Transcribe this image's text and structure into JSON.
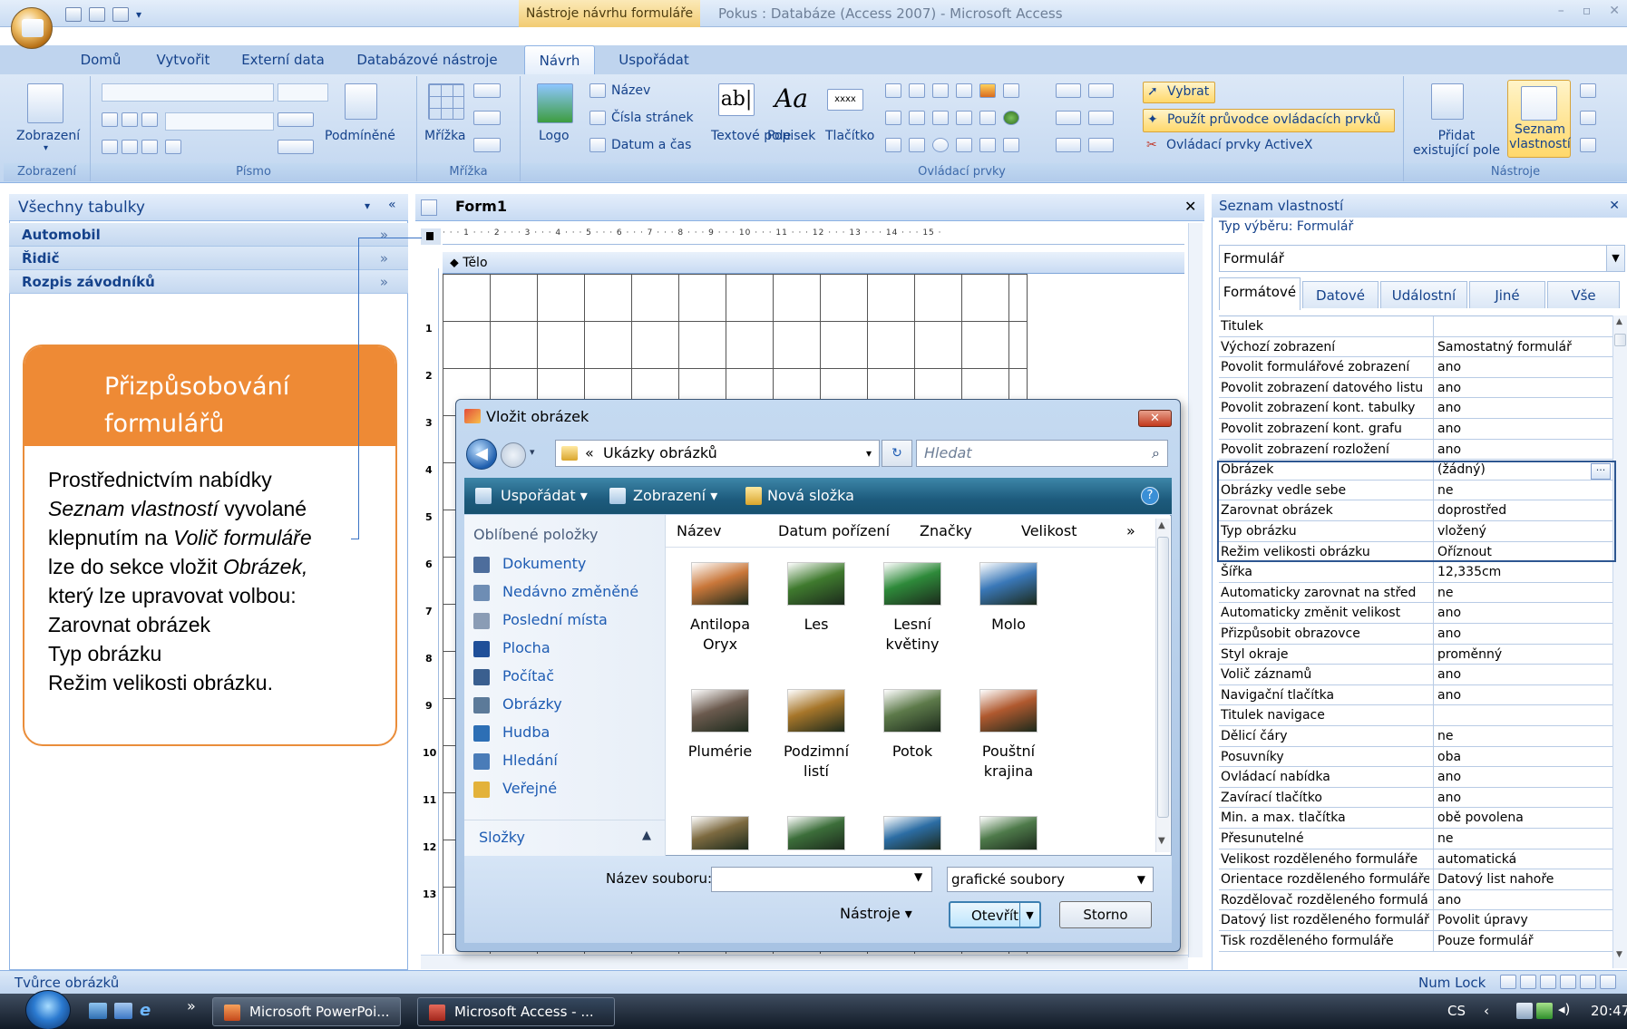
{
  "app": {
    "window_title": "Pokus : Databáze (Access 2007) - Microsoft Access",
    "context_tab": "Nástroje návrhu formuláře"
  },
  "ribbon": {
    "tabs": [
      "Domů",
      "Vytvořit",
      "Externí data",
      "Databázové nástroje",
      "Návrh",
      "Uspořádat"
    ],
    "active_tab": "Návrh",
    "groups": {
      "zobrazeni": {
        "label": "Zobrazení",
        "button": "Zobrazení"
      },
      "pismo": {
        "label": "Písmo",
        "podminene": "Podmíněné"
      },
      "mrizka": {
        "label": "Mřížka",
        "button": "Mřížka"
      },
      "ovladaci_prvky": {
        "label": "Ovládací prvky",
        "logo": "Logo",
        "nazev": "Název",
        "cisla_stranek": "Čísla stránek",
        "datum_cas": "Datum a čas",
        "textove_pole": "Textové pole",
        "textove_pole_ico": "ab|",
        "popisek": "Popisek",
        "popisek_ico": "Aa",
        "tlacitko": "Tlačítko",
        "tlacitko_ico": "xxxx",
        "vybrat": "Vybrat",
        "pouzit_pruvodce": "Použít průvodce ovládacích prvků",
        "activex": "Ovládací prvky ActiveX"
      },
      "nastroje": {
        "label": "Nástroje",
        "pridat_pole": "Přidat existující pole",
        "seznam_vlastnosti": "Seznam vlastností"
      }
    }
  },
  "nav_pane": {
    "title": "Všechny tabulky",
    "groups": [
      "Automobil",
      "Řidič",
      "Rozpis závodníků"
    ]
  },
  "callout": {
    "title": "Přizpůsobování formulářů",
    "lines": [
      {
        "plain": "Prostřednictvím nabídky",
        "italic": ""
      },
      {
        "plain": "",
        "italic": "Seznam vlastností",
        "after": " vyvolané"
      },
      {
        "plain": "klepnutím na ",
        "italic": "Volič formuláře"
      },
      {
        "plain": "lze do sekce vložit ",
        "italic": "Obrázek,"
      },
      {
        "plain": "který lze upravovat volbou:",
        "italic": ""
      },
      {
        "plain": "Zarovnat obrázek",
        "italic": ""
      },
      {
        "plain": "Typ obrázku",
        "italic": ""
      },
      {
        "plain": "Režim velikosti obrázku.",
        "italic": ""
      }
    ]
  },
  "form_doc": {
    "tab": "Form1",
    "section": "Tělo",
    "ruler": "· · · 1 · · · 2 · · · 3 · · · 4 · · · 5 · · · 6 · · · 7 · · · 8 · · · 9 · · · 10 · · · 11 · · · 12 · · · 13 · · · 14 · · · 15 ·",
    "vruler": [
      "1",
      "2",
      "3",
      "4",
      "5",
      "6",
      "7",
      "8",
      "9",
      "10",
      "11",
      "12",
      "13"
    ]
  },
  "dialog": {
    "title": "Vložit obrázek",
    "address": "Ukázky obrázků",
    "address_prefix": "«",
    "search_placeholder": "Hledat",
    "toolbar": {
      "organize": "Uspořádat",
      "views": "Zobrazení",
      "new_folder": "Nová složka"
    },
    "favorites_label": "Oblíbené položky",
    "favorites": [
      "Dokumenty",
      "Nedávno změněné",
      "Poslední místa",
      "Plocha",
      "Počítač",
      "Obrázky",
      "Hudba",
      "Hledání",
      "Veřejné"
    ],
    "folders_label": "Složky",
    "columns": [
      "Název",
      "Datum pořízení",
      "Značky",
      "Velikost"
    ],
    "files": [
      {
        "name": "Antilopa Oryx",
        "color": "#c9773a"
      },
      {
        "name": "Les",
        "color": "#3f7a2e"
      },
      {
        "name": "Lesní květiny",
        "color": "#2e8a3a"
      },
      {
        "name": "Molo",
        "color": "#3a78b8"
      },
      {
        "name": "Plumérie",
        "color": "#6b5a4e"
      },
      {
        "name": "Podzimní listí",
        "color": "#a7762a"
      },
      {
        "name": "Potok",
        "color": "#5d7a4a"
      },
      {
        "name": "Pouštní krajina",
        "color": "#b0592f"
      },
      {
        "name": "",
        "color": "#7d6a40"
      },
      {
        "name": "",
        "color": "#3c6e3a"
      },
      {
        "name": "",
        "color": "#2c6da4"
      },
      {
        "name": "",
        "color": "#4e7a4a"
      }
    ],
    "filename_label": "Název souboru:",
    "filename_value": "",
    "filetype": "grafické soubory",
    "tools": "Nástroje",
    "open": "Otevřít",
    "cancel": "Storno"
  },
  "property_sheet": {
    "title": "Seznam vlastností",
    "selection_type": "Typ výběru:  Formulář",
    "object": "Formulář",
    "tabs": [
      "Formátové",
      "Datové",
      "Událostní",
      "Jiné",
      "Vše"
    ],
    "active_tab": "Formátové",
    "rows": [
      {
        "name": "Titulek",
        "value": ""
      },
      {
        "name": "Výchozí zobrazení",
        "value": "Samostatný formulář"
      },
      {
        "name": "Povolit formulářové zobrazení",
        "value": "ano"
      },
      {
        "name": "Povolit zobrazení datového listu",
        "value": "ano"
      },
      {
        "name": "Povolit zobrazení kont. tabulky",
        "value": "ano"
      },
      {
        "name": "Povolit zobrazení kont. grafu",
        "value": "ano"
      },
      {
        "name": "Povolit zobrazení rozložení",
        "value": "ano"
      },
      {
        "name": "Obrázek",
        "value": "(žádný)"
      },
      {
        "name": "Obrázky vedle sebe",
        "value": "ne"
      },
      {
        "name": "Zarovnat obrázek",
        "value": "doprostřed"
      },
      {
        "name": "Typ obrázku",
        "value": "vložený"
      },
      {
        "name": "Režim velikosti obrázku",
        "value": "Oříznout"
      },
      {
        "name": "Šířka",
        "value": "12,335cm"
      },
      {
        "name": "Automaticky zarovnat na střed",
        "value": "ne"
      },
      {
        "name": "Automaticky změnit velikost",
        "value": "ano"
      },
      {
        "name": "Přizpůsobit obrazovce",
        "value": "ano"
      },
      {
        "name": "Styl okraje",
        "value": "proměnný"
      },
      {
        "name": "Volič záznamů",
        "value": "ano"
      },
      {
        "name": "Navigační tlačítka",
        "value": "ano"
      },
      {
        "name": "Titulek navigace",
        "value": ""
      },
      {
        "name": "Dělicí čáry",
        "value": "ne"
      },
      {
        "name": "Posuvníky",
        "value": "oba"
      },
      {
        "name": "Ovládací nabídka",
        "value": "ano"
      },
      {
        "name": "Zavírací tlačítko",
        "value": "ano"
      },
      {
        "name": "Min. a max. tlačítka",
        "value": "obě povolena"
      },
      {
        "name": "Přesunutelné",
        "value": "ne"
      },
      {
        "name": "Velikost rozděleného formuláře",
        "value": "automatická"
      },
      {
        "name": "Orientace rozděleného formuláře",
        "value": "Datový list nahoře"
      },
      {
        "name": "Rozdělovač rozděleného formulář",
        "value": "ano"
      },
      {
        "name": "Datový list rozděleného formuláře",
        "value": "Povolit úpravy"
      },
      {
        "name": "Tisk rozděleného formuláře",
        "value": "Pouze formulář"
      }
    ]
  },
  "status_bar": {
    "left": "Tvůrce obrázků",
    "num_lock": "Num Lock"
  },
  "taskbar": {
    "items": [
      "Microsoft PowerPoi...",
      "Microsoft Access - ..."
    ],
    "lang": "CS",
    "time": "20:47"
  }
}
